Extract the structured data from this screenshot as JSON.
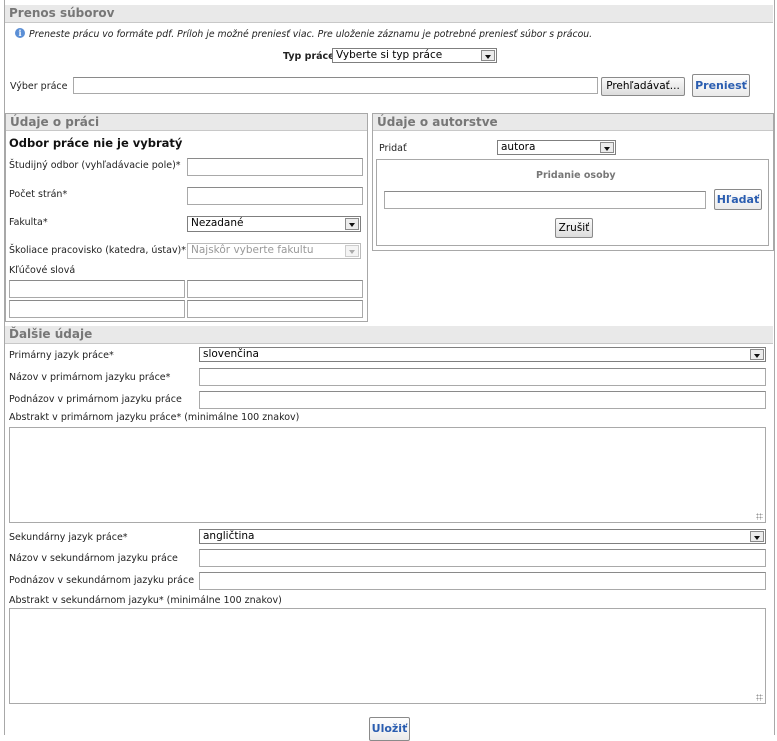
{
  "transfer": {
    "title": "Prenos súborov",
    "info": "Preneste prácu vo formáte pdf. Príloh je možné preniesť viac. Pre uloženie záznamu je potrebné preniesť súbor s prácou.",
    "type_label": "Typ práce",
    "type_value": "Vyberte si typ práce",
    "file_label": "Výber práce",
    "browse_label": "Prehľadávať...",
    "upload_label": "Preniesť"
  },
  "work": {
    "title": "Údaje o práci",
    "subtitle": "Odbor práce nie je vybratý",
    "field_label": "Študijný odbor (vyhľadávacie pole)*",
    "pages_label": "Počet strán*",
    "faculty_label": "Fakulta*",
    "faculty_value": "Nezadané",
    "dept_label": "Školiace pracovisko (katedra, ústav)*",
    "dept_value": "Najskôr vyberte fakultu",
    "keywords_label": "Kľúčové slová"
  },
  "authorship": {
    "title": "Údaje o autorstve",
    "add_label": "Pridať",
    "add_value": "autora",
    "person_title": "Pridanie osoby",
    "search_label": "Hľadať",
    "cancel_label": "Zrušiť"
  },
  "more": {
    "title": "Ďalšie údaje",
    "primary_lang_label": "Primárny jazyk práce*",
    "primary_lang_value": "slovenčina",
    "primary_title_label": "Názov v primárnom jazyku práce*",
    "primary_subtitle_label": "Podnázov v primárnom jazyku práce",
    "primary_abstract_label": "Abstrakt v primárnom jazyku práce* (minimálne 100 znakov)",
    "secondary_lang_label": "Sekundárny jazyk práce*",
    "secondary_lang_value": "angličtina",
    "secondary_title_label": "Názov v sekundárnom jazyku práce",
    "secondary_subtitle_label": "Podnázov v sekundárnom jazyku práce",
    "secondary_abstract_label": "Abstrakt v sekundárnom jazyku* (minimálne 100 znakov)",
    "save_label": "Uložiť"
  },
  "colors": {
    "header_bg": "#e9e9e9",
    "header_text": "#777777",
    "link_blue": "#2a5db0"
  },
  "icons": {
    "info": "info-icon"
  }
}
